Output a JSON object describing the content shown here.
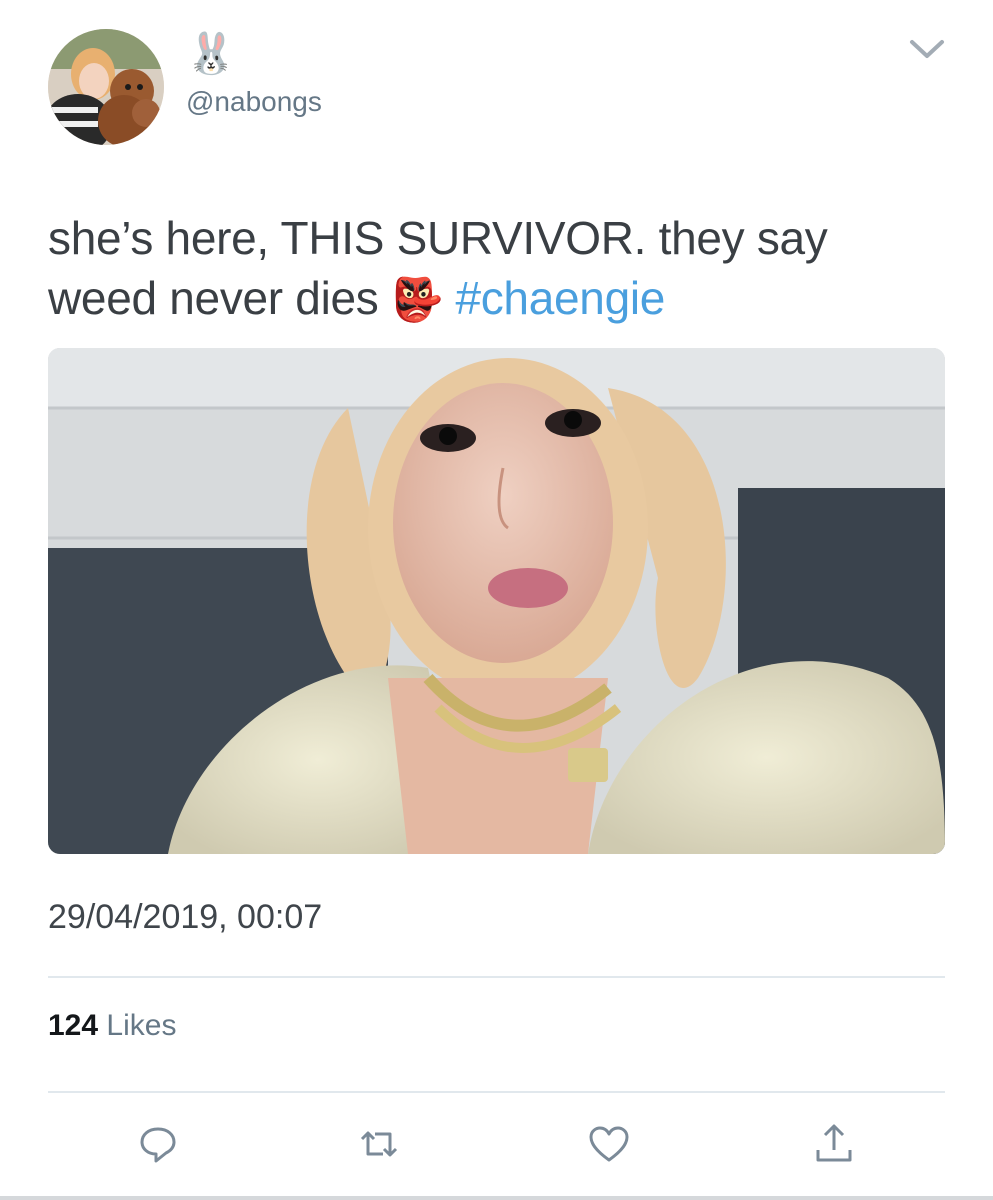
{
  "author": {
    "display_name": "🐰",
    "handle": "@nabongs",
    "avatar_icon": "user-avatar-photo"
  },
  "tweet": {
    "text_main": "she’s here, THIS SURVIVOR. they say weed never dies ",
    "emoji": "👺",
    "hashtag": "#chaengie",
    "media_description_icon": "photo-image",
    "timestamp": "29/04/2019, 00:07"
  },
  "stats": {
    "likes_count": "124",
    "likes_label": "Likes"
  },
  "actions": {
    "reply_icon": "reply-icon",
    "retweet_icon": "retweet-icon",
    "like_icon": "heart-icon",
    "share_icon": "share-icon",
    "more_icon": "chevron-down-icon"
  },
  "colors": {
    "link": "#4a9fde",
    "secondary_text": "#657786",
    "icon": "#7b8a98",
    "divider": "#e1e8ed"
  }
}
